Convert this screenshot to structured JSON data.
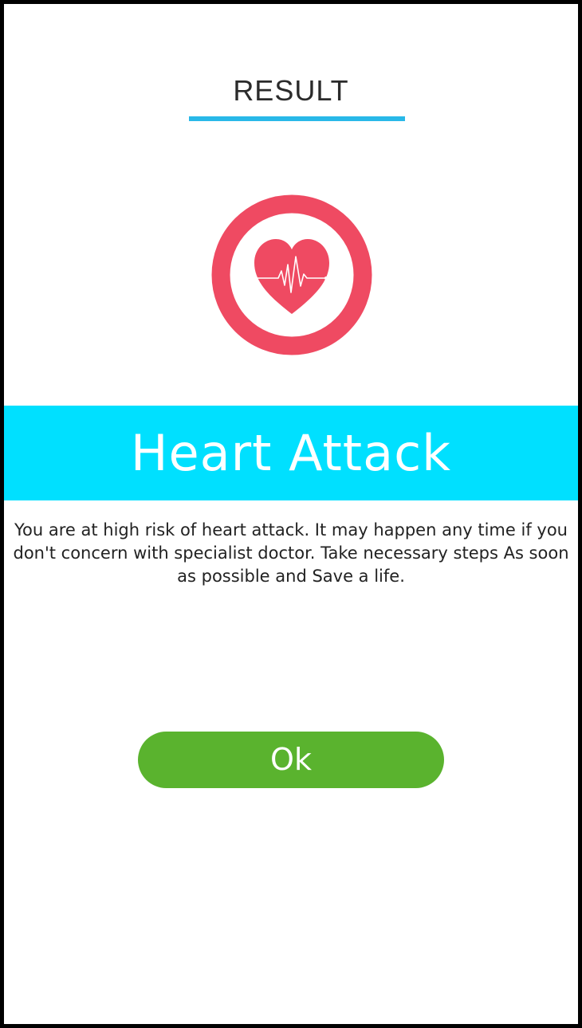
{
  "header": {
    "title": "RESULT",
    "underline_color": "#29b8e8"
  },
  "icon": {
    "name": "heart-pulse-icon",
    "ring_color": "#ef4a62",
    "heart_color": "#ef4a62"
  },
  "result": {
    "label": "Heart Attack",
    "banner_color": "#00e0ff",
    "message": "You are at high risk of heart attack. It may happen any time if you don't concern with specialist doctor. Take necessary steps As soon as possible and Save a life."
  },
  "actions": {
    "ok_label": "Ok",
    "ok_color": "#5ab32e"
  }
}
